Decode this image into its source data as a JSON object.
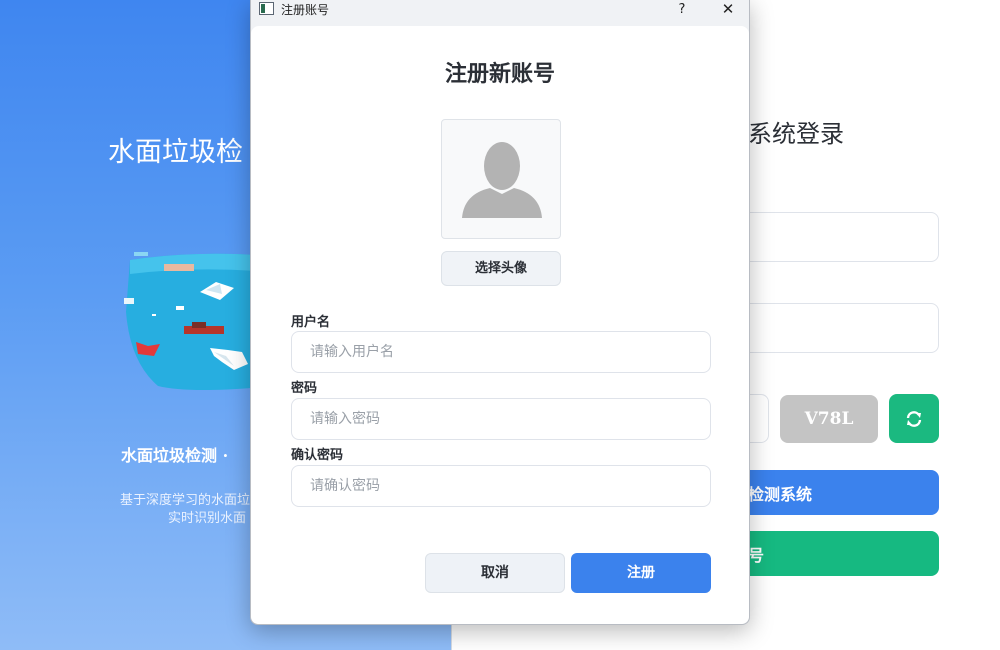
{
  "login_window": {
    "left": {
      "title": "水面垃圾检",
      "subtitle": "水面垃圾检测 ·",
      "description_line1": "基于深度学习的水面垃",
      "description_line2": "实时识别水面"
    },
    "right": {
      "title": "系统登录",
      "captcha_text": "V78L",
      "login_button": "检测系统",
      "register_button": "号"
    },
    "colors": {
      "primary": "#3b82ed",
      "success": "#16b981",
      "captcha_bg": "#c4c4c4"
    }
  },
  "dialog": {
    "window_title": "注册账号",
    "help_label": "?",
    "close_label": "✕",
    "heading": "注册新账号",
    "avatar_icon": "default-user-avatar",
    "choose_avatar_button": "选择头像",
    "username": {
      "label": "用户名",
      "placeholder": "请输入用户名"
    },
    "password": {
      "label": "密码",
      "placeholder": "请输入密码"
    },
    "confirm_password": {
      "label": "确认密码",
      "placeholder": "请确认密码"
    },
    "cancel_button": "取消",
    "submit_button": "注册"
  }
}
